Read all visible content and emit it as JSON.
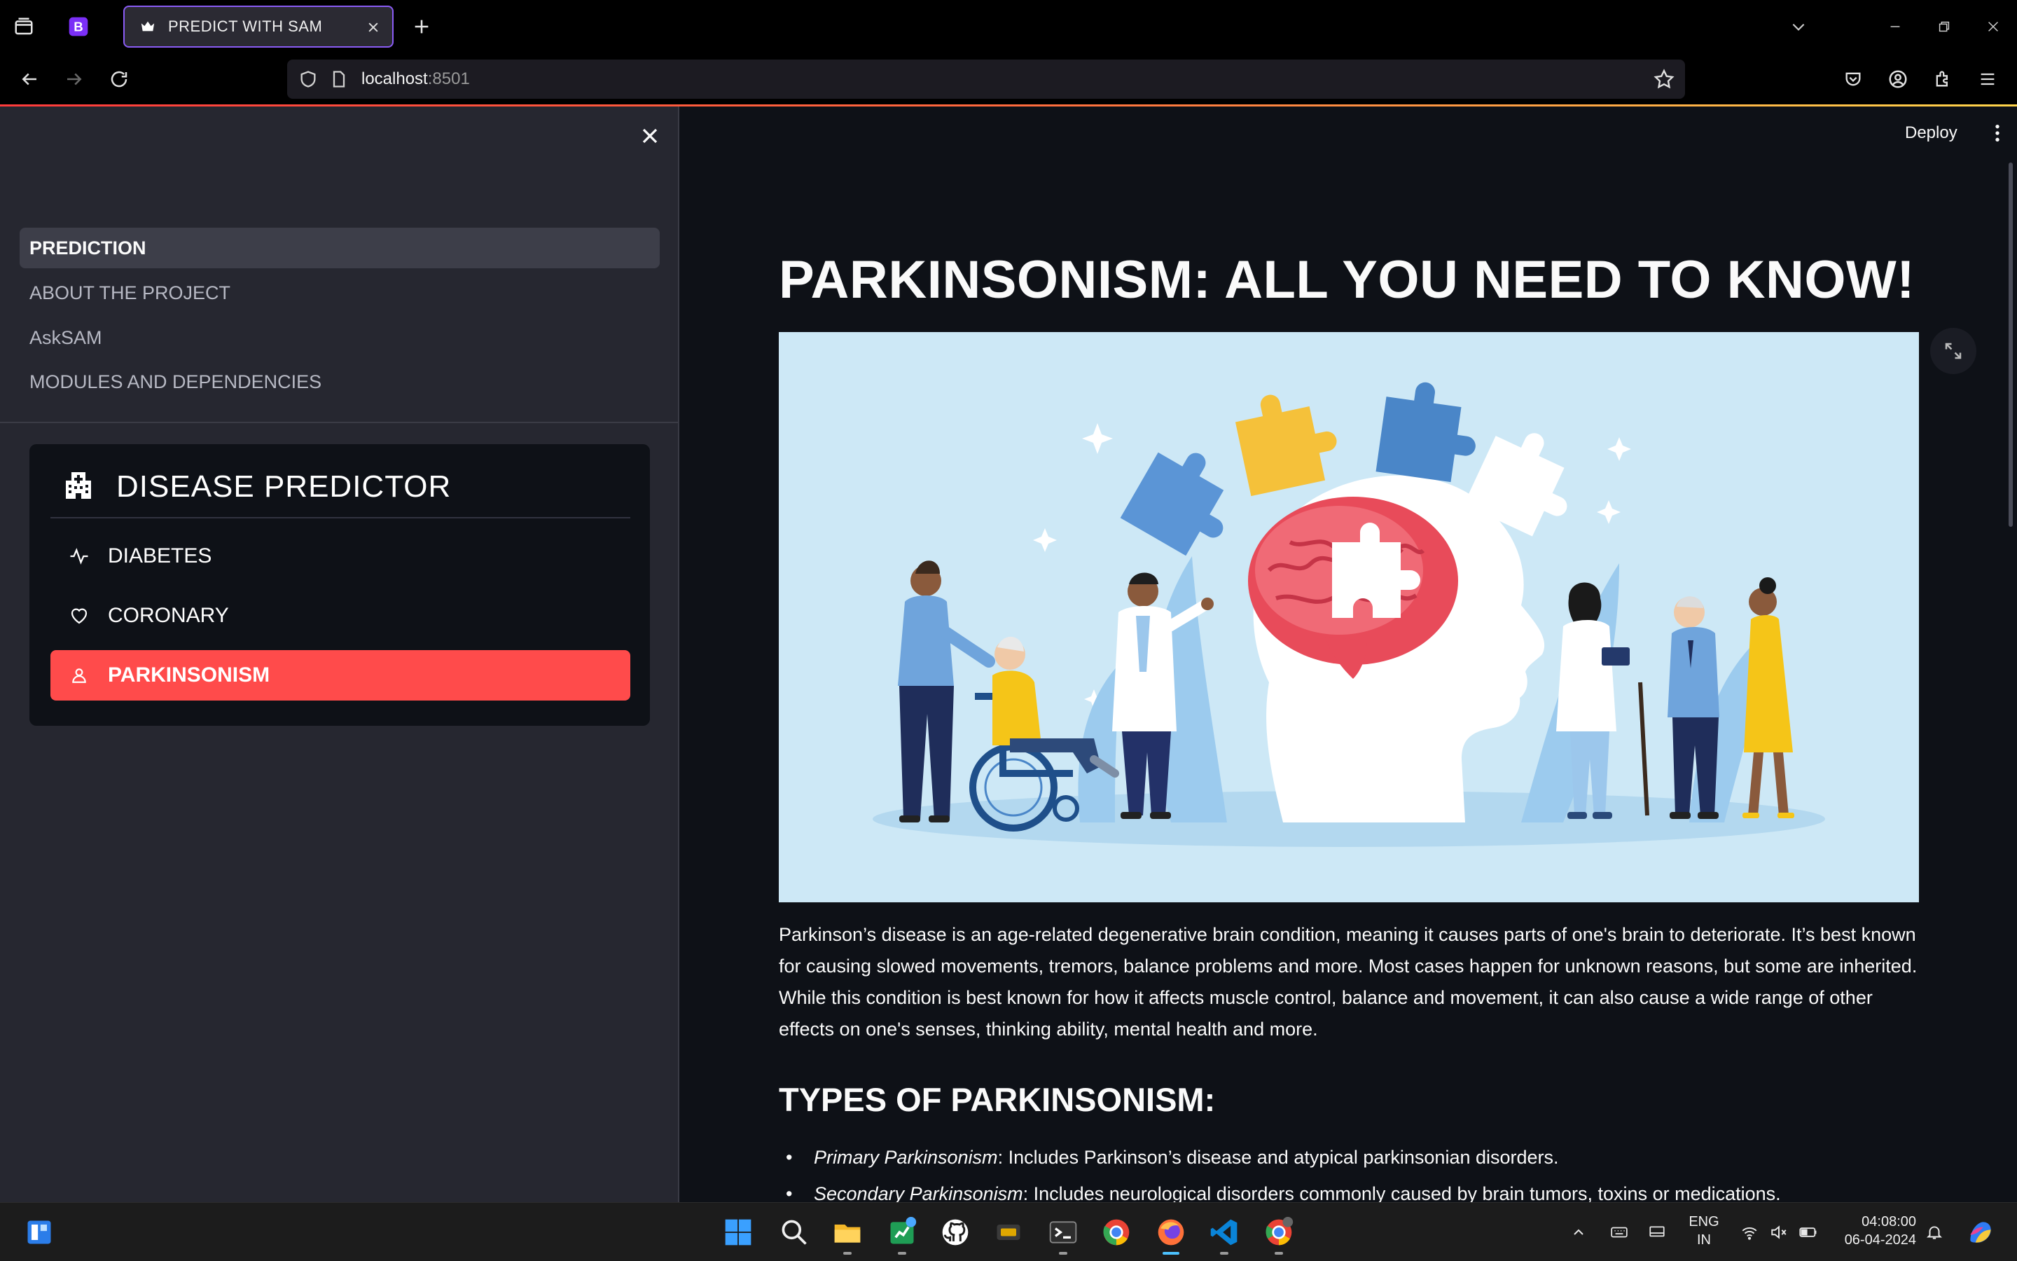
{
  "browser": {
    "tab_title": "PREDICT WITH SAM",
    "url_host": "localhost",
    "url_port": ":8501"
  },
  "sidebar": {
    "nav_items": [
      {
        "label": "PREDICTION",
        "active": true
      },
      {
        "label": "ABOUT THE PROJECT",
        "active": false
      },
      {
        "label": "AskSAM",
        "active": false
      },
      {
        "label": "MODULES AND DEPENDENCIES",
        "active": false
      }
    ],
    "predictor": {
      "title": "DISEASE PREDICTOR",
      "items": [
        {
          "label": "DIABETES",
          "icon": "activity-icon",
          "active": false
        },
        {
          "label": "CORONARY",
          "icon": "heart-icon",
          "active": false
        },
        {
          "label": "PARKINSONISM",
          "icon": "person-icon",
          "active": true
        }
      ]
    }
  },
  "header": {
    "deploy_label": "Deploy"
  },
  "main": {
    "title": "PARKINSONISM: ALL YOU NEED TO KNOW!",
    "paragraph": "Parkinson’s disease is an age-related degenerative brain condition, meaning it causes parts of one's brain to deteriorate. It’s best known for causing slowed movements, tremors, balance problems and more. Most cases happen for unknown reasons, but some are inherited. While this condition is best known for how it affects muscle control, balance and movement, it can also cause a wide range of other effects on one's senses, thinking ability, mental health and more.",
    "subtitle": "TYPES OF PARKINSONISM:",
    "types": [
      {
        "name": "Primary Parkinsonism",
        "desc": ": Includes Parkinson’s disease and atypical parkinsonian disorders."
      },
      {
        "name": "Secondary Parkinsonism",
        "desc": ": Includes neurological disorders commonly caused by brain tumors, toxins or medications."
      }
    ]
  },
  "taskbar": {
    "lang_top": "ENG",
    "lang_bottom": "IN",
    "time": "04:08:00",
    "date": "06-04-2024"
  },
  "colors": {
    "accent": "#ff4b4b",
    "tab_border": "#8b5cf6",
    "sidebar_bg": "#262730",
    "main_bg": "#0e1117"
  }
}
